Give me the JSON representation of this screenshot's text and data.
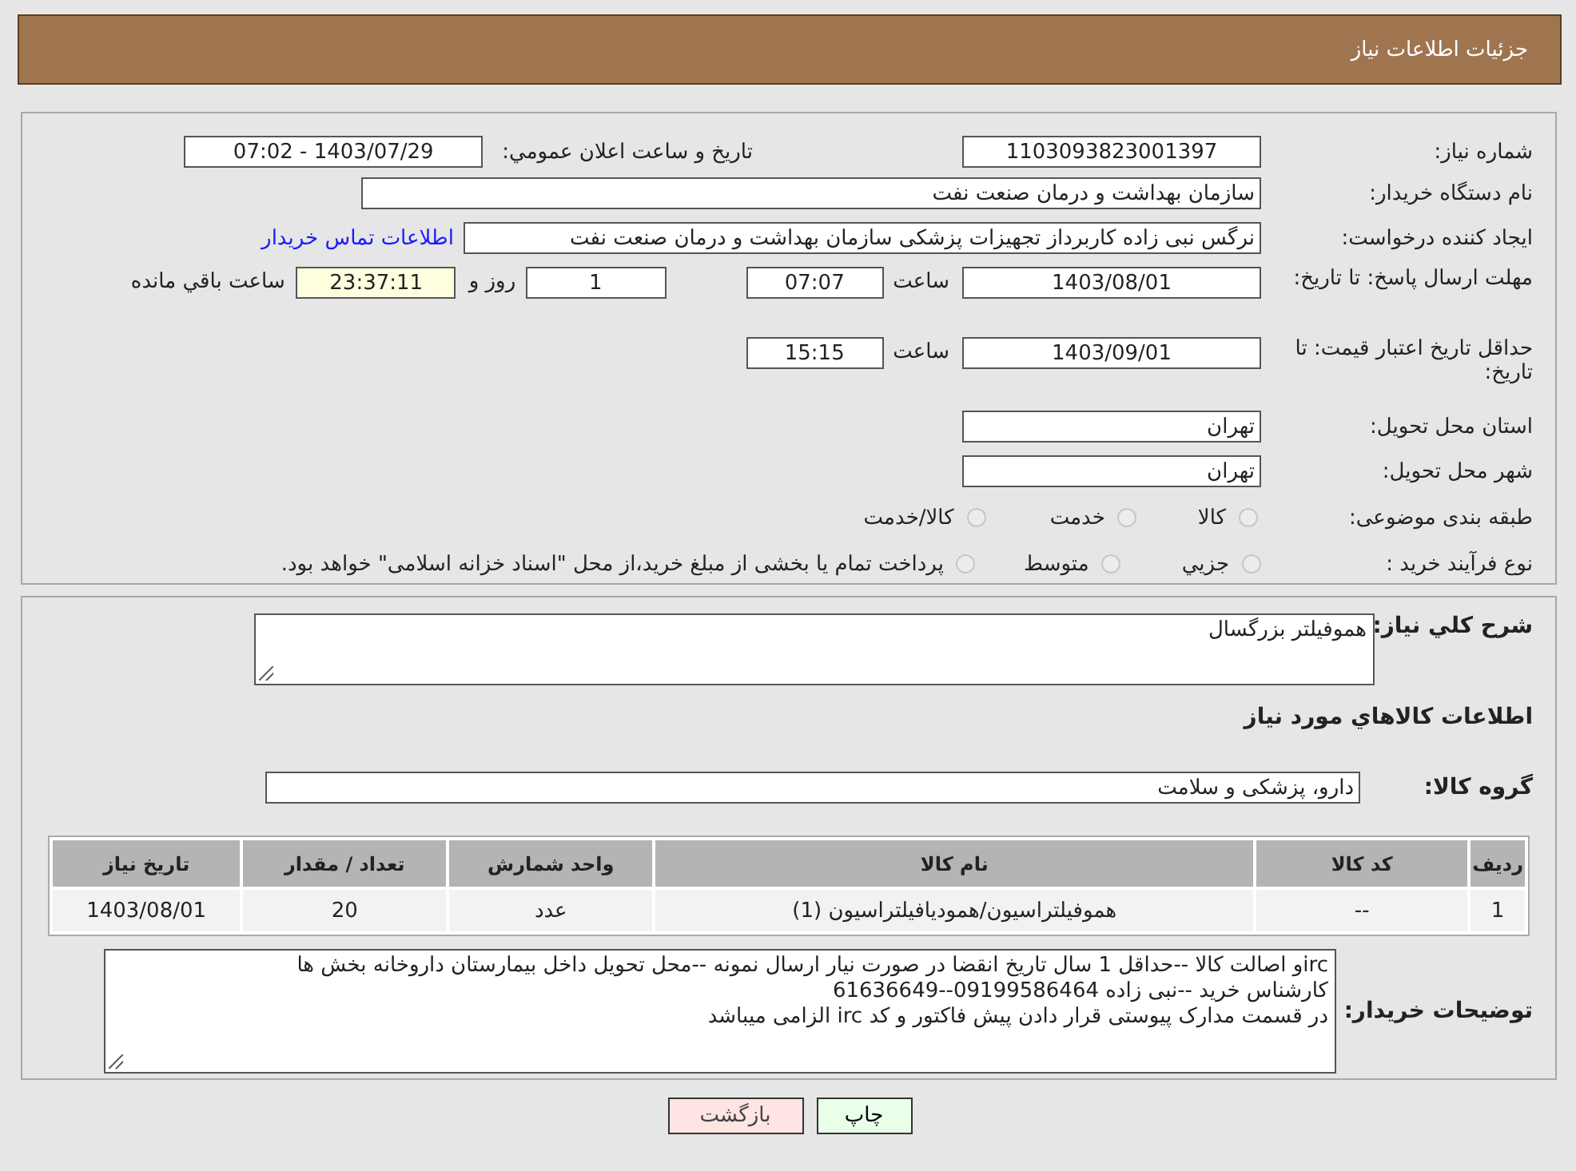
{
  "header": {
    "title": "جزئیات اطلاعات نیاز"
  },
  "details": {
    "need_number": {
      "label": "شماره نیاز:",
      "value": "1103093823001397"
    },
    "announce_date": {
      "label": "تاریخ و ساعت اعلان عمومي:",
      "value": "1403/07/29 - 07:02"
    },
    "buyer_org": {
      "label": "نام دستگاه خریدار:",
      "value": "سازمان بهداشت و درمان صنعت نفت"
    },
    "requester": {
      "label": "ایجاد کننده درخواست:",
      "value": "نرگس نبی زاده کاربرداز تجهیزات پزشکی سازمان بهداشت و درمان صنعت نفت",
      "link": "اطلاعات تماس خریدار"
    },
    "reply_deadline": {
      "label": "مهلت ارسال پاسخ: تا تاریخ:",
      "date": "1403/08/01",
      "time_label": "ساعت",
      "time": "07:07",
      "days": "1",
      "days_label": "روز و",
      "remaining": "23:37:11",
      "remaining_label": "ساعت باقي مانده"
    },
    "price_validity": {
      "label": "حداقل تاریخ اعتبار قیمت: تا تاریخ:",
      "date": "1403/09/01",
      "time_label": "ساعت",
      "time": "15:15"
    },
    "province": {
      "label": "استان محل تحویل:",
      "value": "تهران"
    },
    "city": {
      "label": "شهر محل تحویل:",
      "value": "تهران"
    },
    "category": {
      "label": "طبقه بندی موضوعی:",
      "options": [
        {
          "label": "کالا",
          "selected": false
        },
        {
          "label": "خدمت",
          "selected": false
        },
        {
          "label": "کالا/خدمت",
          "selected": false
        }
      ]
    },
    "process": {
      "label": "نوع فرآیند خرید :",
      "options": [
        {
          "label": "جزيي",
          "selected": false
        },
        {
          "label": "متوسط",
          "selected": false
        },
        {
          "label": "پرداخت تمام یا بخشی از مبلغ خرید،از محل \"اسناد خزانه اسلامی\" خواهد بود.",
          "selected": false
        }
      ]
    }
  },
  "summary": {
    "label": "شرح کلي نیاز:",
    "value": "هموفیلتر بزرگسال"
  },
  "goods_title": "اطلاعات کالاهاي مورد نیاز",
  "goods_group": {
    "label": "گروه کالا:",
    "value": "دارو، پزشکی و سلامت"
  },
  "table": {
    "columns": [
      "ردیف",
      "کد کالا",
      "نام کالا",
      "واحد شمارش",
      "تعداد / مقدار",
      "تاریخ نیاز"
    ],
    "rows": [
      [
        "1",
        "--",
        "هموفیلتراسیون/همودیافیلتراسیون (1)",
        "عدد",
        "20",
        "1403/08/01"
      ]
    ]
  },
  "buyer_notes": {
    "label": "توضیحات خریدار:",
    "lines": [
      "ircو اصالت کالا --حداقل 1 سال تاریخ انقضا در صورت نیار ارسال نمونه --محل تحویل داخل بیمارستان داروخانه بخش ها",
      "کارشناس خرید --نبی زاده 09199586464--61636649",
      "در قسمت مدارک پیوستی قرار دادن پیش فاکتور و کد irc الزامی میباشد"
    ]
  },
  "buttons": [
    {
      "label": "چاپ",
      "kind": "print"
    },
    {
      "label": "بازگشت",
      "kind": "back"
    }
  ]
}
